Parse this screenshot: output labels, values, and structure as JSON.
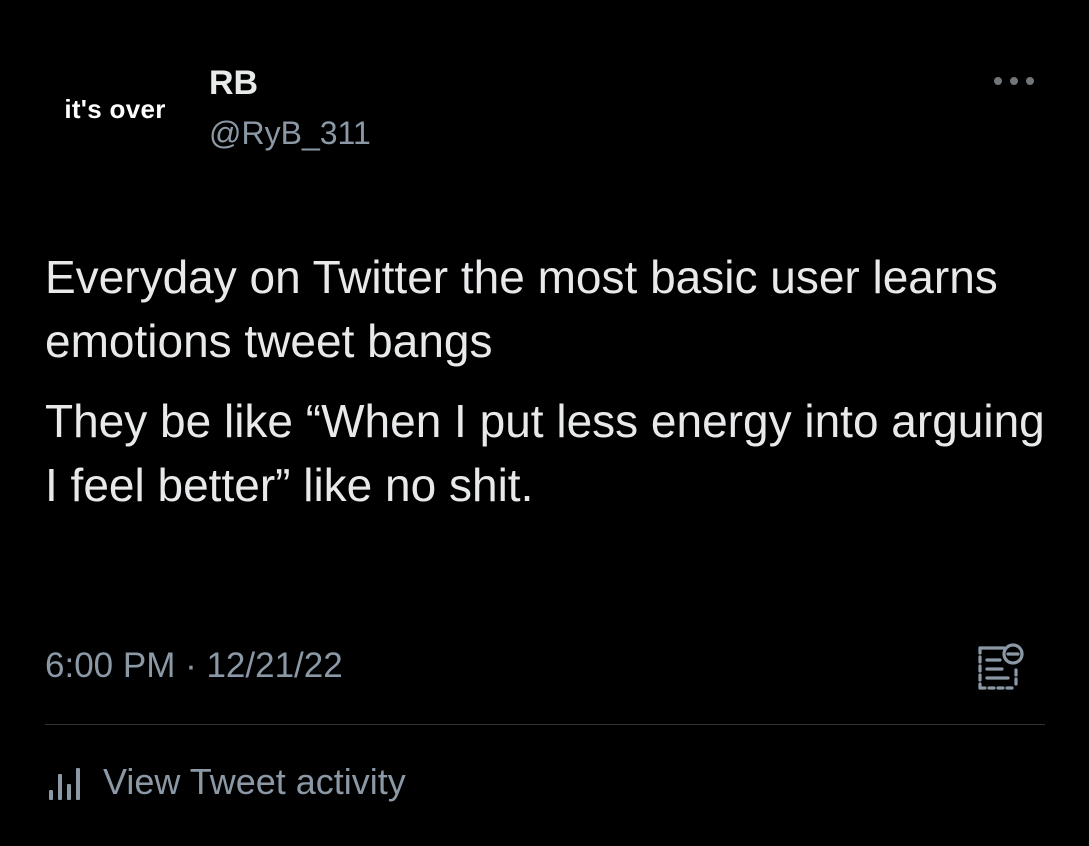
{
  "avatar": {
    "text": "it's over"
  },
  "user": {
    "display_name": "RB",
    "handle": "@RyB_311"
  },
  "tweet": {
    "paragraphs": [
      "Everyday on Twitter the most basic user learns emotions tweet bangs",
      "They be like “When I put less energy into arguing I feel better” like no shit."
    ],
    "timestamp": "6:00 PM · 12/21/22"
  },
  "footer": {
    "activity_label": "View Tweet activity"
  },
  "icons": {
    "more": "more-options-icon",
    "edit": "edit-history-icon",
    "activity": "analytics-bars-icon"
  },
  "colors": {
    "background": "#000000",
    "primary_text": "#e7e9ea",
    "secondary_text": "#8b98a5",
    "divider": "#2f3336"
  }
}
